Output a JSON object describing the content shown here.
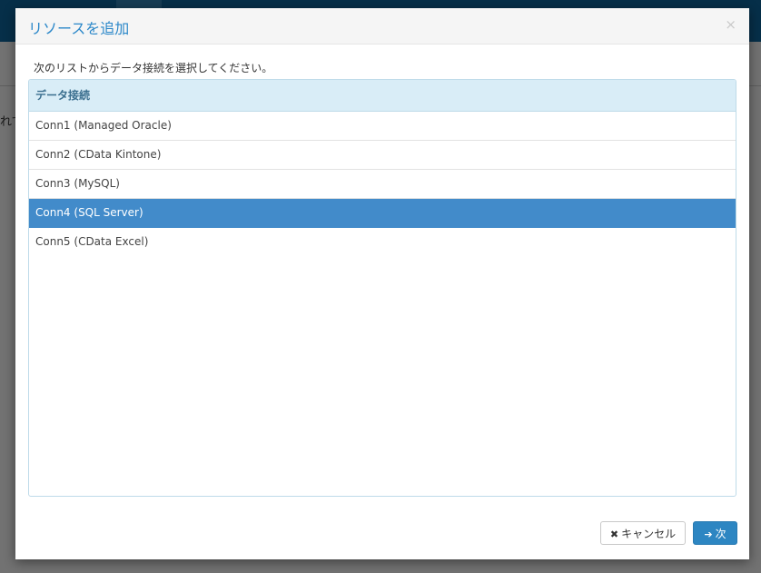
{
  "background": {
    "partial_text": "れて"
  },
  "dialog": {
    "title": "リソースを追加",
    "close_glyph": "×",
    "instruction": "次のリストからデータ接続を選択してください。",
    "grid": {
      "header": "データ接続",
      "rows": [
        {
          "label": "Conn1 (Managed Oracle)",
          "selected": false
        },
        {
          "label": "Conn2 (CData Kintone)",
          "selected": false
        },
        {
          "label": "Conn3 (MySQL)",
          "selected": false
        },
        {
          "label": "Conn4 (SQL Server)",
          "selected": true
        },
        {
          "label": "Conn5 (CData Excel)",
          "selected": false
        }
      ]
    },
    "buttons": {
      "cancel_icon": "✖",
      "cancel_label": "キャンセル",
      "next_icon": "➔",
      "next_label": "次"
    }
  },
  "colors": {
    "accent": "#2a87c9",
    "selected_row": "#428bca",
    "header_bg": "#d9edf7",
    "topbar": "#0c5f93"
  }
}
